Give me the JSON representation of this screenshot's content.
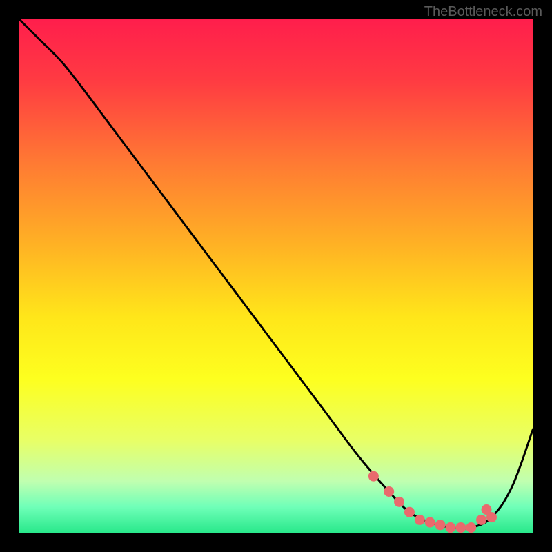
{
  "watermark": "TheBottleneck.com",
  "chart_data": {
    "type": "line",
    "title": "",
    "xlabel": "",
    "ylabel": "",
    "xlim": [
      0,
      100
    ],
    "ylim": [
      0,
      100
    ],
    "grid": false,
    "series": [
      {
        "name": "bottleneck-curve",
        "x": [
          0,
          4,
          8,
          12,
          18,
          24,
          30,
          36,
          42,
          48,
          54,
          60,
          66,
          72,
          76,
          80,
          84,
          88,
          92,
          96,
          100
        ],
        "y": [
          100,
          96,
          92,
          87,
          79,
          71,
          63,
          55,
          47,
          39,
          31,
          23,
          15,
          8,
          4,
          2,
          1,
          1,
          3,
          9,
          20
        ]
      }
    ],
    "markers": {
      "name": "highlight-points",
      "x": [
        69,
        72,
        74,
        76,
        78,
        80,
        82,
        84,
        86,
        88,
        90,
        91,
        92
      ],
      "y": [
        11,
        8,
        6,
        4,
        2.5,
        2,
        1.5,
        1,
        1,
        1,
        2.5,
        4.5,
        3
      ]
    },
    "gradient_stops": [
      {
        "offset": 0.0,
        "color": "#ff1e4c"
      },
      {
        "offset": 0.12,
        "color": "#ff3b42"
      },
      {
        "offset": 0.28,
        "color": "#ff7a33"
      },
      {
        "offset": 0.44,
        "color": "#ffb224"
      },
      {
        "offset": 0.58,
        "color": "#ffe61a"
      },
      {
        "offset": 0.7,
        "color": "#fdff1f"
      },
      {
        "offset": 0.82,
        "color": "#e8ff66"
      },
      {
        "offset": 0.9,
        "color": "#c0ffb0"
      },
      {
        "offset": 0.95,
        "color": "#6fffb8"
      },
      {
        "offset": 1.0,
        "color": "#29e88b"
      }
    ],
    "marker_color": "#e96a6d",
    "curve_color": "#000000"
  }
}
